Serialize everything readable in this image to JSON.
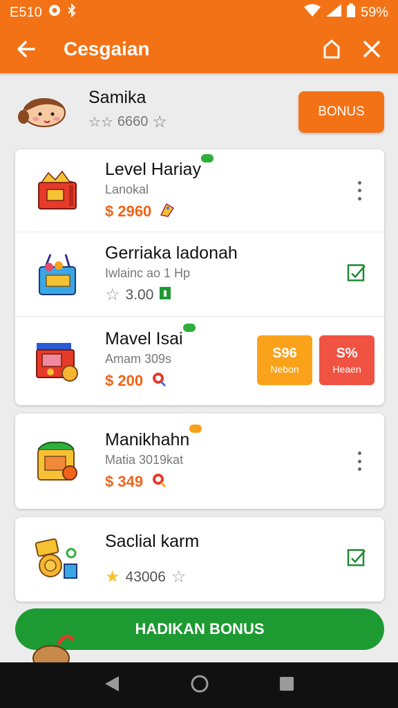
{
  "status_bar": {
    "time": "E510",
    "battery": "59%"
  },
  "app_bar": {
    "title": "Cesgaian",
    "back_icon": "arrow-left-icon",
    "share_icon": "share-icon",
    "close_icon": "close-icon"
  },
  "user": {
    "name": "Samika",
    "rating_text": "6660",
    "bonus_label": "BONUS"
  },
  "items_card_1": [
    {
      "title": "Level Hariay",
      "subtitle": "Lanokal",
      "price": "$ 2960",
      "trailing": "menu"
    },
    {
      "title": "Gerriaka ladonah",
      "subtitle": "Iwlainc ao 1 Hp",
      "rating": "3.00",
      "trailing": "check"
    },
    {
      "title": "Mavel Isai",
      "subtitle": "Amam 309s",
      "price": "$ 200",
      "actions": [
        {
          "value": "S96",
          "label": "Nebon"
        },
        {
          "value": "S%",
          "label": "Heaen"
        }
      ]
    }
  ],
  "items_card_2": {
    "title": "Manikhahn",
    "subtitle": "Matia 3019kat",
    "price": "$ 349",
    "trailing": "menu"
  },
  "items_card_3": {
    "title": "Saclial karm",
    "rating": "43006",
    "trailing": "check"
  },
  "primary_button": {
    "label": "HADIKAN BONUS"
  },
  "colors": {
    "accent": "#f47216",
    "primary_green": "#1d9a32",
    "price": "#f06418",
    "action_orange": "#fba21b",
    "action_red": "#f05342"
  },
  "nav": {
    "back": "triangle-back-icon",
    "home": "circle-home-icon",
    "recents": "square-recents-icon"
  }
}
